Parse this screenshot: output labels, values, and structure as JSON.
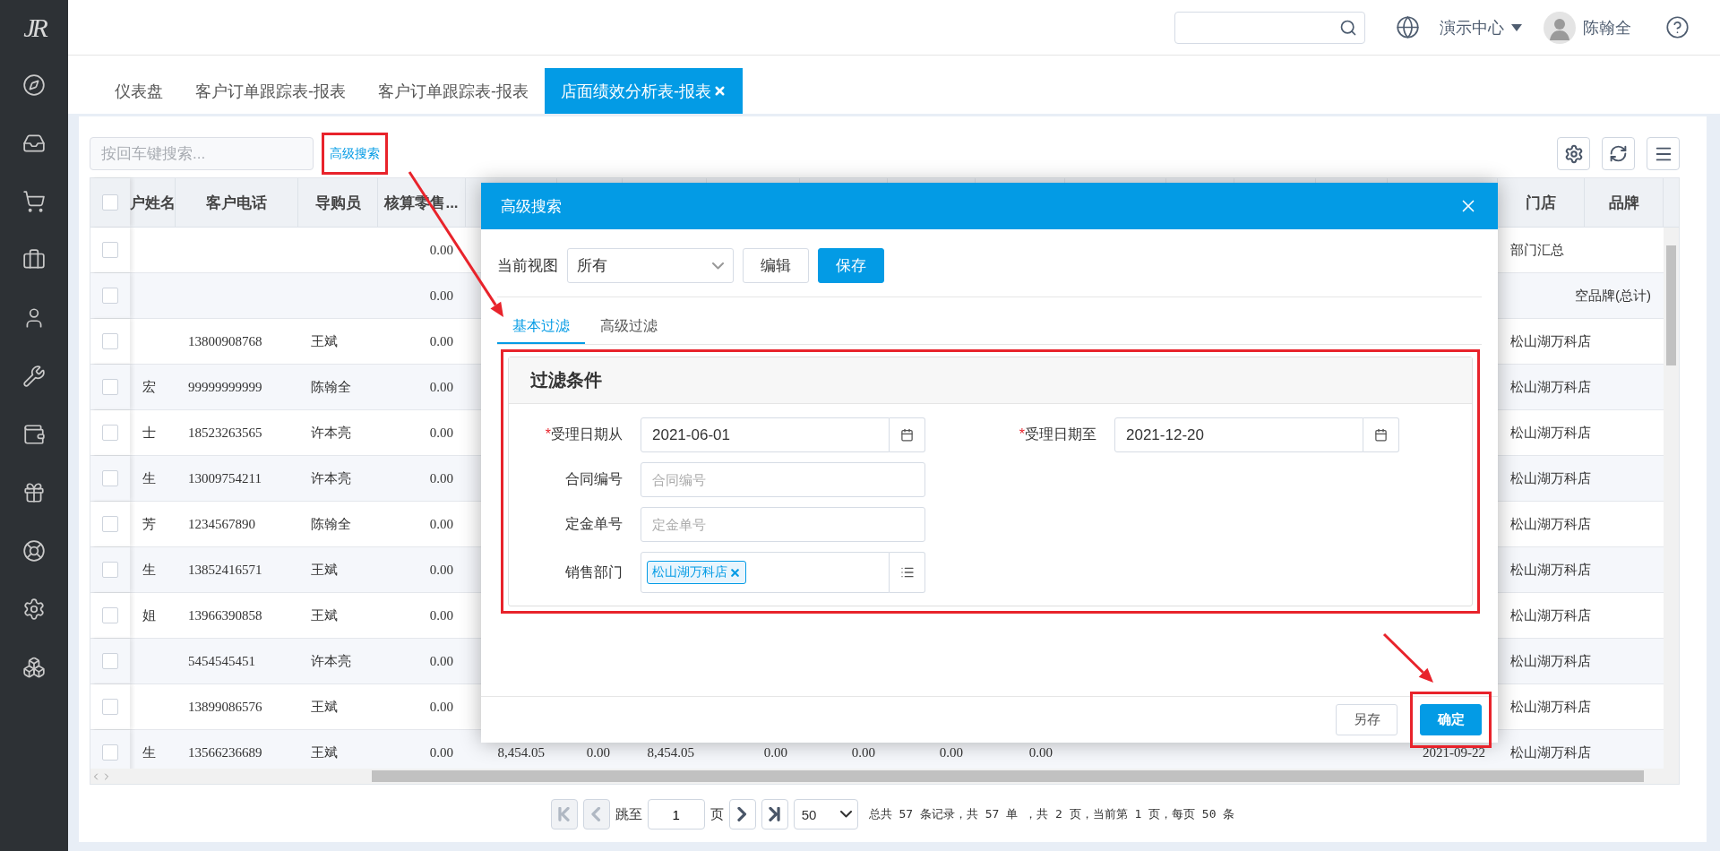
{
  "sidebar": {
    "logo": "JR"
  },
  "header": {
    "region_menu": "演示中心",
    "user_name": "陈翰全"
  },
  "tabs": [
    {
      "label": "仪表盘",
      "selected": false,
      "closable": false
    },
    {
      "label": "客户订单跟踪表-报表",
      "selected": false,
      "closable": false
    },
    {
      "label": "客户订单跟踪表-报表",
      "selected": false,
      "closable": false
    },
    {
      "label": "店面绩效分析表-报表",
      "selected": true,
      "closable": true
    }
  ],
  "toolbar": {
    "search_placeholder": "按回车键搜索...",
    "advanced_search": {
      "label": "高级搜索",
      "highlighted": true
    }
  },
  "table": {
    "select_all_checked": false,
    "columns": [
      "户姓名",
      "客户电话",
      "导购员",
      "核算零售...",
      "门店",
      "品牌"
    ],
    "rows": [
      {
        "checked": false,
        "cells": {
          "retail": "0.00",
          "store": "部门汇总"
        }
      },
      {
        "checked": false,
        "cells": {
          "retail": "0.00",
          "brand": "空品牌(总计)"
        }
      },
      {
        "checked": false,
        "cells": {
          "phone": "13800908768",
          "guide": "王斌",
          "retail": "0.00",
          "store": "松山湖万科店"
        }
      },
      {
        "checked": false,
        "cells": {
          "customer_name": "宏",
          "phone": "99999999999",
          "guide": "陈翰全",
          "retail": "0.00",
          "store": "松山湖万科店"
        }
      },
      {
        "checked": false,
        "cells": {
          "customer_name": "士",
          "phone": "18523263565",
          "guide": "许本亮",
          "retail": "0.00",
          "store": "松山湖万科店"
        }
      },
      {
        "checked": false,
        "cells": {
          "customer_name": "生",
          "phone": "13009754211",
          "guide": "许本亮",
          "retail": "0.00",
          "store": "松山湖万科店"
        }
      },
      {
        "checked": false,
        "cells": {
          "customer_name": "芳",
          "phone": "1234567890",
          "guide": "陈翰全",
          "retail": "0.00",
          "store": "松山湖万科店"
        }
      },
      {
        "checked": false,
        "cells": {
          "customer_name": "生",
          "phone": "13852416571",
          "guide": "王斌",
          "retail": "0.00",
          "store": "松山湖万科店"
        }
      },
      {
        "checked": false,
        "cells": {
          "customer_name": "姐",
          "phone": "13966390858",
          "guide": "王斌",
          "retail": "0.00",
          "store": "松山湖万科店"
        }
      },
      {
        "checked": false,
        "cells": {
          "phone": "5454545451",
          "guide": "许本亮",
          "retail": "0.00",
          "store": "松山湖万科店"
        }
      },
      {
        "checked": false,
        "cells": {
          "phone": "13899086576",
          "guide": "王斌",
          "retail": "0.00",
          "store": "松山湖万科店"
        }
      },
      {
        "checked": false,
        "cells": {
          "customer_name": "生",
          "phone": "13566236689",
          "guide": "王斌",
          "retail": "0.00",
          "column_6": "8,454.05",
          "column_7": "0.00",
          "column_8": "8,454.05",
          "column_9": "0.00",
          "column_10": "0.00",
          "column_11": "0.00",
          "column_12": "0.00",
          "column_17": "2021-09-22",
          "store": "松山湖万科店"
        }
      }
    ]
  },
  "pagination": {
    "nav_before": [
      {
        "kind": "first",
        "disabled": true
      },
      {
        "kind": "prev",
        "disabled": true
      }
    ],
    "jump_label": "跳至",
    "page_input": "1",
    "page_suffix": "页",
    "nav_after": [
      {
        "kind": "next",
        "disabled": false
      },
      {
        "kind": "last",
        "disabled": false
      }
    ],
    "page_size": "50",
    "summary": "总共 57 条记录，共 57 单 ，共 2 页，当前第 1 页，每页 50 条"
  },
  "dialog": {
    "title": "高级搜索",
    "view_label": "当前视图",
    "view_value": "所有",
    "edit_button": "编辑",
    "save_button": "保存",
    "tabs": [
      {
        "label": "基本过滤",
        "selected": true
      },
      {
        "label": "高级过滤",
        "selected": false
      }
    ],
    "panel_title": "过滤条件",
    "panel_highlighted": true,
    "rows": [
      {
        "fields": [
          {
            "kind": "date",
            "label": "受理日期从",
            "required_mark": "*",
            "value": "2021-06-01"
          },
          {
            "kind": "date",
            "label": "受理日期至",
            "required_mark": "*",
            "value": "2021-12-20"
          }
        ]
      },
      {
        "fields": [
          {
            "kind": "text",
            "label": "合同编号",
            "placeholder": "合同编号"
          }
        ]
      },
      {
        "fields": [
          {
            "kind": "text",
            "label": "定金单号",
            "placeholder": "定金单号"
          }
        ]
      },
      {
        "fields": [
          {
            "kind": "tags",
            "label": "销售部门",
            "tags": [
              "松山湖万科店"
            ]
          }
        ]
      }
    ],
    "footer_buttons": [
      {
        "label": "另存",
        "kind": "secondary",
        "highlighted": false
      },
      {
        "label": "确定",
        "kind": "primary",
        "highlighted": true
      }
    ]
  }
}
